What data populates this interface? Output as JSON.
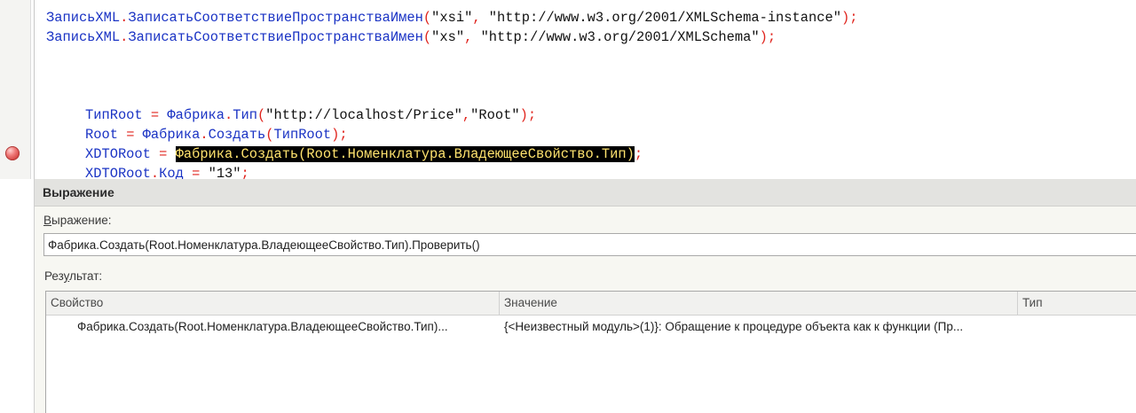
{
  "editor": {
    "lines": {
      "l1": {
        "obj": "ЗаписьXML",
        "dot": ".",
        "method": "ЗаписатьСоответствиеПространстваИмен",
        "open": "(",
        "arg1": "\"xsi\"",
        "comma": ", ",
        "arg2": "\"http://www.w3.org/2001/XMLSchema-instance\"",
        "close": ");"
      },
      "l2": {
        "obj": "ЗаписьXML",
        "dot": ".",
        "method": "ЗаписатьСоответствиеПространстваИмен",
        "open": "(",
        "arg1": "\"xs\"",
        "comma": ", ",
        "arg2": "\"http://www.w3.org/2001/XMLSchema\"",
        "close": ");"
      },
      "l3": {
        "var": "ТипRoot",
        "eq": " = ",
        "obj": "Фабрика",
        "dot": ".",
        "method": "Тип",
        "open": "(",
        "arg1": "\"http://localhost/Price\"",
        "comma": ",",
        "arg2": "\"Root\"",
        "close": ");"
      },
      "l4": {
        "var": "Root",
        "eq": " = ",
        "obj": "Фабрика",
        "dot": ".",
        "method": "Создать",
        "open": "(",
        "arg": "ТипRoot",
        "close": ");"
      },
      "l5": {
        "var": "XDTORoot",
        "eq": " = ",
        "hl_obj": "Фабрика",
        "hl_dot1": ".",
        "hl_method": "Создать",
        "hl_open": "(",
        "hl_arg": "Root.Номенклатура.ВладеющееСвойство.Тип",
        "hl_close": ")",
        "end": ";"
      },
      "l6": {
        "var": "XDTORoot",
        "dot": ".",
        "field": "Код",
        "eq": " = ",
        "val": "\"13\"",
        "end": ";"
      }
    }
  },
  "panel": {
    "title": "Выражение",
    "expression_label_first": "В",
    "expression_label_rest": "ыражение:",
    "expression_value": "Фабрика.Создать(Root.Номенклатура.ВладеющееСвойство.Тип).Проверить()",
    "result_label_a": "Рез",
    "result_label_u": "у",
    "result_label_b": "льтат:",
    "columns": [
      "Свойство",
      "Значение",
      "Тип"
    ],
    "rows": [
      {
        "property": "Фабрика.Создать(Root.Номенклатура.ВладеющееСвойство.Тип)...",
        "value": "{<Неизвестный модуль>(1)}: Обращение к процедуре объекта как к функции (Пр...",
        "type": ""
      }
    ]
  },
  "colors": {
    "identifier": "#1a33c4",
    "operator": "#e0241d",
    "string": "#111111",
    "highlight_bg": "#000000",
    "highlight_fg": "#ffe36e",
    "breakpoint": "#d2403e",
    "panel_bg": "#f7f7f2",
    "header_bg": "#e3e3e0"
  },
  "icons": {
    "breakpoint": "breakpoint-icon"
  }
}
